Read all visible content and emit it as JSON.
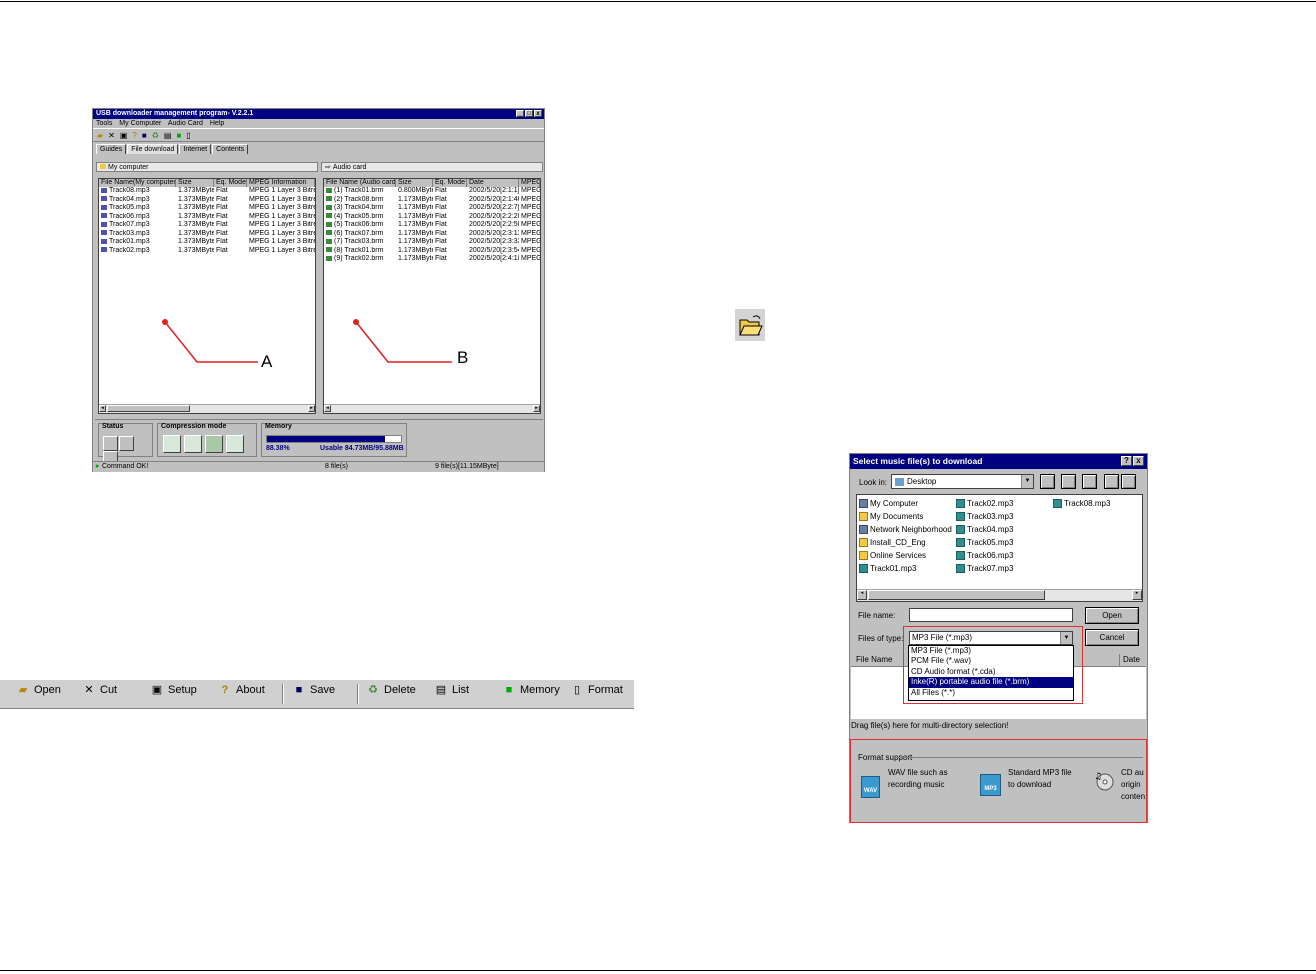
{
  "main_window": {
    "title": "USB downloader management program- V.2.2.1",
    "title_controls": [
      "_",
      "□",
      "x"
    ],
    "menu": [
      "Tools",
      "My Computer",
      "Audio Card",
      "Help"
    ],
    "tabs": [
      "Guides",
      "File download",
      "Internet",
      "Contents"
    ],
    "left_panel": {
      "label": "My computer",
      "columns": [
        "File Name(My computer)",
        "Size",
        "Eq. Mode",
        "MPEG Information"
      ],
      "rows": [
        [
          "Track08.mp3",
          "1.373MByte",
          "Flat",
          "MPEG 1 Layer 3 Bitre"
        ],
        [
          "Track04.mp3",
          "1.373MByte",
          "Flat",
          "MPEG 1 Layer 3 Bitre"
        ],
        [
          "Track05.mp3",
          "1.373MByte",
          "Flat",
          "MPEG 1 Layer 3 Bitre"
        ],
        [
          "Track06.mp3",
          "1.373MByte",
          "Flat",
          "MPEG 1 Layer 3 Bitre"
        ],
        [
          "Track07.mp3",
          "1.373MByte",
          "Flat",
          "MPEG 1 Layer 3 Bitre"
        ],
        [
          "Track03.mp3",
          "1.373MByte",
          "Flat",
          "MPEG 1 Layer 3 Bitre"
        ],
        [
          "Track01.mp3",
          "1.373MByte",
          "Flat",
          "MPEG 1 Layer 3 Bitre"
        ],
        [
          "Track02.mp3",
          "1.373MByte",
          "Flat",
          "MPEG 1 Layer 3 Bitre"
        ]
      ],
      "callout": "A"
    },
    "right_panel": {
      "label": "Audio card",
      "columns": [
        "File Name (Audio card)",
        "Size",
        "Eq. Mode",
        "Date",
        "MPEG"
      ],
      "rows": [
        [
          "(1) Track01.brm",
          "0.800MByte",
          "Flat",
          "2002/5/20[2:1:1]",
          "MPEG"
        ],
        [
          "(2) Track08.brm",
          "1.173MByte",
          "Flat",
          "2002/5/20[2:1:46]",
          "MPEG"
        ],
        [
          "(3) Track04.brm",
          "1.173MByte",
          "Flat",
          "2002/5/20[2:2:7]",
          "MPEG"
        ],
        [
          "(4) Track05.brm",
          "1.173MByte",
          "Flat",
          "2002/5/20[2:2:28]",
          "MPEG"
        ],
        [
          "(5) Track06.brm",
          "1.173MByte",
          "Flat",
          "2002/5/20[2:2:50]",
          "MPEG"
        ],
        [
          "(6) Track07.brm",
          "1.173MByte",
          "Flat",
          "2002/5/20[2:3:11]",
          "MPEG"
        ],
        [
          "(7) Track03.brm",
          "1.173MByte",
          "Flat",
          "2002/5/20[2:3:33]",
          "MPEG"
        ],
        [
          "(8) Track01.brm",
          "1.173MByte",
          "Flat",
          "2002/5/20[2:3:54]",
          "MPEG"
        ],
        [
          "(9) Track02.brm",
          "1.173MByte",
          "Flat",
          "2002/5/20[2:4:18]",
          "MPEG"
        ]
      ],
      "callout": "B"
    },
    "status_section": {
      "status_label": "Status",
      "compression_label": "Compression mode",
      "memory_label": "Memory",
      "memory_percent": "88.38%",
      "memory_fill": 0.8838,
      "memory_usable": "Usable 84.73MB/95.88MB"
    },
    "statusbar": [
      "Command OK!",
      "8 file(s)",
      "9 file(s)[11.15MByte]"
    ]
  },
  "toolbar_strip": {
    "items": [
      {
        "icon": "open-folder-icon",
        "label": "Open"
      },
      {
        "icon": "cut-icon",
        "label": "Cut"
      },
      {
        "icon": "setup-icon",
        "label": "Setup"
      },
      {
        "icon": "question-icon",
        "label": "About"
      },
      {
        "icon": "floppy-icon",
        "label": "Save"
      },
      {
        "icon": "delete-icon",
        "label": "Delete"
      },
      {
        "icon": "list-icon",
        "label": "List"
      },
      {
        "icon": "memory-icon",
        "label": "Memory"
      },
      {
        "icon": "format-icon",
        "label": "Format"
      }
    ]
  },
  "open_icon_large": "open-folder-icon",
  "dialog": {
    "title": "Select music file(s) to download",
    "title_controls": [
      "?",
      "x"
    ],
    "look_in_label": "Look in:",
    "look_in_value": "Desktop",
    "col1": [
      "My Computer",
      "My Documents",
      "Network Neighborhood",
      "Install_CD_Eng",
      "Online Services",
      "Track01.mp3"
    ],
    "col2": [
      "Track02.mp3",
      "Track03.mp3",
      "Track04.mp3",
      "Track05.mp3",
      "Track06.mp3",
      "Track07.mp3"
    ],
    "col3": [
      "Track08.mp3"
    ],
    "file_name_label": "File name:",
    "file_name_value": "",
    "open_button": "Open",
    "files_of_type_label": "Files of type:",
    "files_of_type_value": "MP3 File (*.mp3)",
    "cancel_button": "Cancel",
    "dropdown_options": [
      "MP3 File (*.mp3)",
      "PCM File (*.wav)",
      "CD Audio format (*.cda)",
      "Inke(R) portable audio file (*.brm)",
      "All Files (*.*)"
    ],
    "selected_option": "Inke(R) portable audio file (*.brm)",
    "list_header_name": "File Name",
    "list_header_date": "Date",
    "drag_hint": "Drag file(s) here  for multi-directory selection!",
    "format_support_label": "Format support",
    "formats": [
      {
        "badge": "WAV",
        "text_line1": "WAV file such as",
        "text_line2": "recording music"
      },
      {
        "badge": "MP3",
        "text_line1": "Standard MP3 file",
        "text_line2": "to download"
      },
      {
        "badge": "",
        "text_line1": "CD au",
        "text_line2": "origin",
        "text_line3": "conten"
      }
    ],
    "colors": {
      "title": "#000080",
      "highlight": "#e03030"
    }
  }
}
